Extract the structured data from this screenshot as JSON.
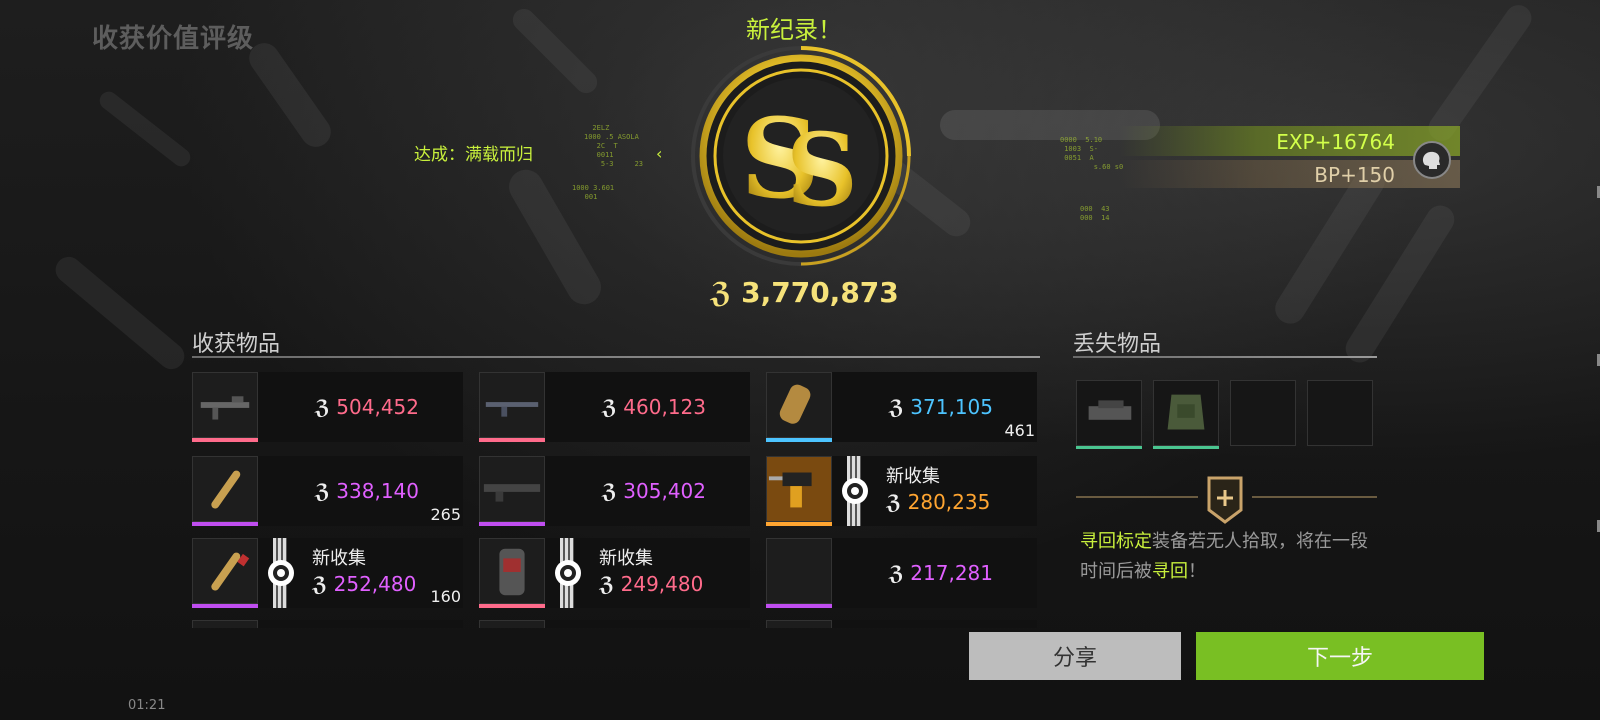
{
  "header": {
    "title": "收获价值评级",
    "new_record": "新纪录！"
  },
  "rank": {
    "letters": "SS",
    "achievement": "达成：满载而归"
  },
  "rewards": {
    "exp": "EXP+16764",
    "bp": "BP+150"
  },
  "total_value": "3,770,873",
  "collected": {
    "title": "收获物品",
    "items": [
      {
        "name": "rifle-1",
        "value": "504,452",
        "color": "#ff6b8b",
        "bar": "#ff6b8b",
        "qty": "",
        "new": false,
        "new_label": ""
      },
      {
        "name": "rifle-2",
        "value": "460,123",
        "color": "#ff6b8b",
        "bar": "#ff6b8b",
        "qty": "",
        "new": false,
        "new_label": ""
      },
      {
        "name": "shell",
        "value": "371,105",
        "color": "#4dc4ff",
        "bar": "#4dc4ff",
        "qty": "461",
        "new": false,
        "new_label": ""
      },
      {
        "name": "ammo-1",
        "value": "338,140",
        "color": "#e060ff",
        "bar": "#c04ef0",
        "qty": "265",
        "new": false,
        "new_label": ""
      },
      {
        "name": "rifle-3",
        "value": "305,402",
        "color": "#e060ff",
        "bar": "#c04ef0",
        "qty": "",
        "new": false,
        "new_label": ""
      },
      {
        "name": "drill",
        "value": "280,235",
        "color": "#ffa531",
        "bar": "#ffa531",
        "qty": "",
        "new": true,
        "new_label": "新收集"
      },
      {
        "name": "ammo-2",
        "value": "252,480",
        "color": "#e060ff",
        "bar": "#c04ef0",
        "qty": "160",
        "new": true,
        "new_label": "新收集"
      },
      {
        "name": "armor",
        "value": "249,480",
        "color": "#ff6b8b",
        "bar": "#ff6b8b",
        "qty": "",
        "new": true,
        "new_label": "新收集"
      },
      {
        "name": "empty",
        "value": "217,281",
        "color": "#e060ff",
        "bar": "#c04ef0",
        "qty": "",
        "new": false,
        "new_label": ""
      }
    ]
  },
  "lost": {
    "title": "丢失物品",
    "tracker_hl1": "寻回标定",
    "tracker_text": "装备若无人拾取，将在一段时间后被",
    "tracker_hl2": "寻回",
    "tracker_end": "！"
  },
  "buttons": {
    "share": "分享",
    "next": "下一步"
  },
  "clock": "01:21"
}
